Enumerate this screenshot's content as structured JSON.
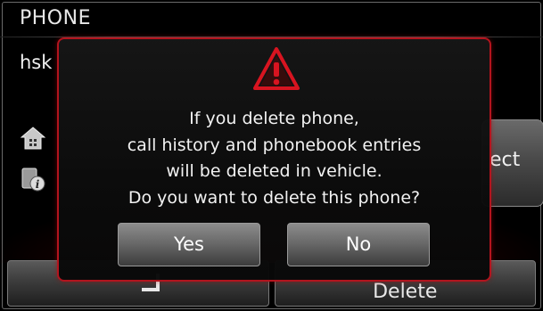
{
  "header": {
    "title": "PHONE"
  },
  "device": {
    "name": "hsk"
  },
  "side_icons": [
    "home-icon",
    "info-icon"
  ],
  "background_buttons": {
    "right_partial_label": "ect",
    "bottom_right_label": "Delete"
  },
  "dialog": {
    "icon": "warning-triangle-icon",
    "message_lines": [
      "If you delete phone,",
      "call history and phonebook entries",
      "will be deleted in vehicle.",
      "Do you want to delete this phone?"
    ],
    "yes_label": "Yes",
    "no_label": "No"
  },
  "colors": {
    "accent_red": "#b3141e",
    "background": "#000000",
    "text": "#f2f2f2"
  }
}
